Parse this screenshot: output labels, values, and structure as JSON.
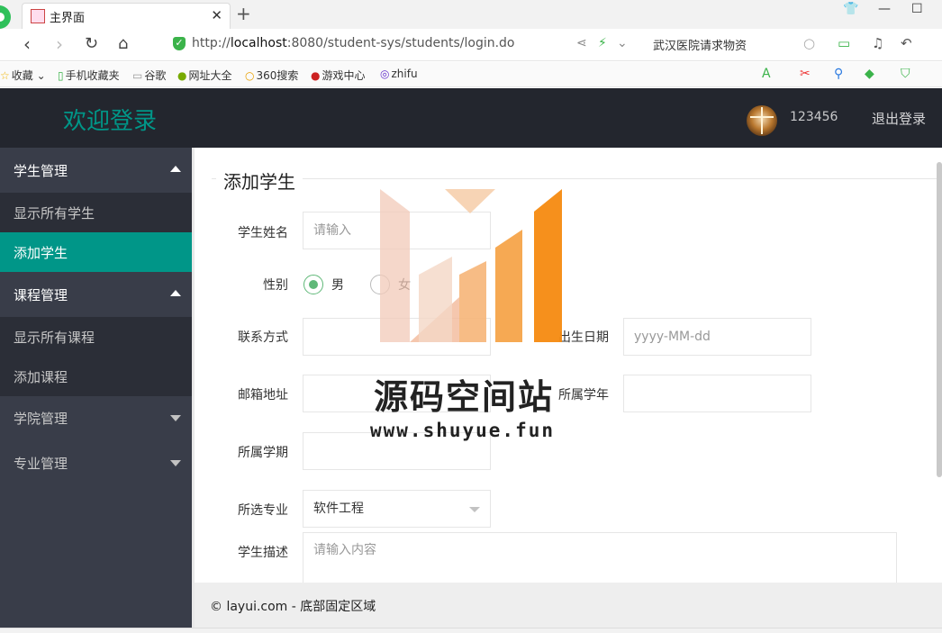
{
  "browser": {
    "tab_title": "主界面",
    "url_prefix": "http://",
    "url_host": "localhost",
    "url_path": ":8080/student-sys/students/login.do",
    "search_text": "武汉医院请求物资",
    "bookmarks": [
      "收藏",
      "手机收藏夹",
      "谷歌",
      "网址大全",
      "360搜索",
      "游戏中心",
      "zhifu"
    ]
  },
  "header": {
    "logo": "欢迎登录",
    "username": "123456",
    "logout": "退出登录"
  },
  "sidebar": {
    "groups": [
      {
        "label": "学生管理",
        "children": [
          "显示所有学生",
          "添加学生"
        ]
      },
      {
        "label": "课程管理",
        "children": [
          "显示所有课程",
          "添加课程"
        ]
      },
      {
        "label": "学院管理"
      },
      {
        "label": "专业管理"
      }
    ]
  },
  "form": {
    "legend": "添加学生",
    "name_label": "学生姓名",
    "name_placeholder": "请输入",
    "gender_label": "性别",
    "gender_male": "男",
    "gender_female": "女",
    "phone_label": "联系方式",
    "birth_label": "出生日期",
    "birth_placeholder": "yyyy-MM-dd",
    "email_label": "邮箱地址",
    "year_label": "所属学年",
    "term_label": "所属学期",
    "major_label": "所选专业",
    "major_value": "软件工程",
    "desc_label": "学生描述",
    "desc_placeholder": "请输入内容"
  },
  "footer": {
    "text": "© layui.com - 底部固定区域"
  },
  "watermark": {
    "title": "源码空间站",
    "url": "www.shuyue.fun"
  },
  "colors": {
    "accent": "#009688",
    "header_bg": "#23262e",
    "sidebar_bg": "#393d49",
    "radio": "#5fb878"
  }
}
